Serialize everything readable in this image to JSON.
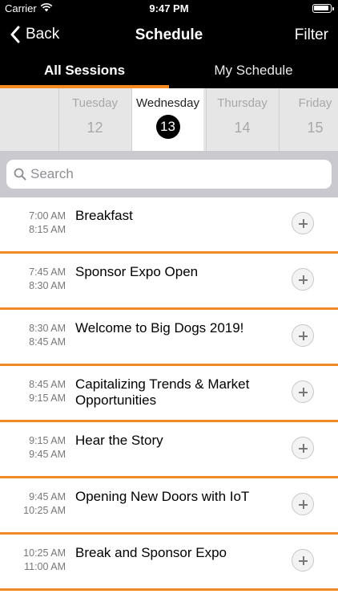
{
  "status_bar": {
    "carrier": "Carrier",
    "time": "9:47 PM"
  },
  "nav": {
    "back_label": "Back",
    "title": "Schedule",
    "filter_label": "Filter"
  },
  "tabs": [
    {
      "label": "All Sessions",
      "active": true
    },
    {
      "label": "My Schedule",
      "active": false
    }
  ],
  "dates": [
    {
      "day": "Tuesday",
      "num": "12",
      "selected": false
    },
    {
      "day": "Wednesday",
      "num": "13",
      "selected": true
    },
    {
      "day": "Thursday",
      "num": "14",
      "selected": false
    },
    {
      "day": "Friday",
      "num": "15",
      "selected": false
    }
  ],
  "search": {
    "placeholder": "Search",
    "value": ""
  },
  "sessions": [
    {
      "start": "7:00 AM",
      "end": "8:15 AM",
      "title": "Breakfast"
    },
    {
      "start": "7:45 AM",
      "end": "8:30 AM",
      "title": "Sponsor Expo Open"
    },
    {
      "start": "8:30 AM",
      "end": "8:45 AM",
      "title": "Welcome to Big Dogs 2019!"
    },
    {
      "start": "8:45 AM",
      "end": "9:15 AM",
      "title": "Capitalizing Trends & Market Opportunities"
    },
    {
      "start": "9:15 AM",
      "end": "9:45 AM",
      "title": "Hear the Story"
    },
    {
      "start": "9:45 AM",
      "end": "10:25 AM",
      "title": "Opening New Doors with IoT"
    },
    {
      "start": "10:25 AM",
      "end": "11:00 AM",
      "title": "Break and Sponsor Expo"
    }
  ],
  "colors": {
    "accent": "#f58a1f",
    "bar_background": "#000000",
    "date_strip": "#e6e6e6",
    "search_background": "#c9c9cf"
  },
  "icons": {
    "wifi": "wifi-icon",
    "battery": "battery-icon",
    "back": "chevron-left-icon",
    "search": "search-icon",
    "add": "plus-circle-icon"
  }
}
